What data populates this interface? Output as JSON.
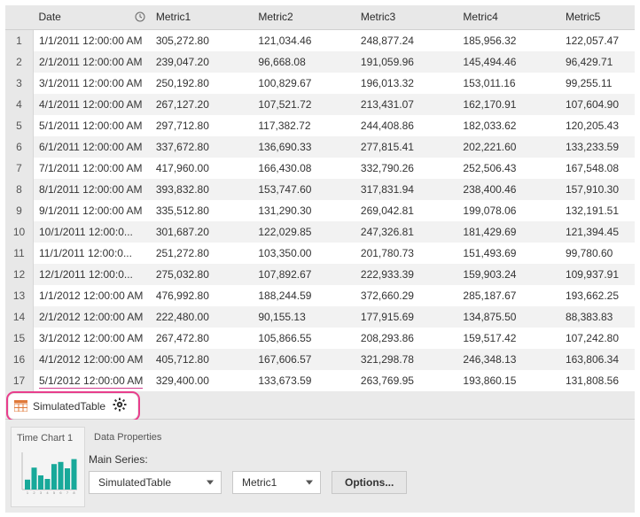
{
  "columns": [
    "Date",
    "Metric1",
    "Metric2",
    "Metric3",
    "Metric4",
    "Metric5"
  ],
  "rows": [
    {
      "n": 1,
      "date": "1/1/2011 12:00:00 AM",
      "m1": "305,272.80",
      "m2": "121,034.46",
      "m3": "248,877.24",
      "m4": "185,956.32",
      "m5": "122,057.47"
    },
    {
      "n": 2,
      "date": "2/1/2011 12:00:00 AM",
      "m1": "239,047.20",
      "m2": "96,668.08",
      "m3": "191,059.96",
      "m4": "145,494.46",
      "m5": "96,429.71"
    },
    {
      "n": 3,
      "date": "3/1/2011 12:00:00 AM",
      "m1": "250,192.80",
      "m2": "100,829.67",
      "m3": "196,013.32",
      "m4": "153,011.16",
      "m5": "99,255.11"
    },
    {
      "n": 4,
      "date": "4/1/2011 12:00:00 AM",
      "m1": "267,127.20",
      "m2": "107,521.72",
      "m3": "213,431.07",
      "m4": "162,170.91",
      "m5": "107,604.90"
    },
    {
      "n": 5,
      "date": "5/1/2011 12:00:00 AM",
      "m1": "297,712.80",
      "m2": "117,382.72",
      "m3": "244,408.86",
      "m4": "182,033.62",
      "m5": "120,205.43"
    },
    {
      "n": 6,
      "date": "6/1/2011 12:00:00 AM",
      "m1": "337,672.80",
      "m2": "136,690.33",
      "m3": "277,815.41",
      "m4": "202,221.60",
      "m5": "133,233.59"
    },
    {
      "n": 7,
      "date": "7/1/2011 12:00:00 AM",
      "m1": "417,960.00",
      "m2": "166,430.08",
      "m3": "332,790.26",
      "m4": "252,506.43",
      "m5": "167,548.08"
    },
    {
      "n": 8,
      "date": "8/1/2011 12:00:00 AM",
      "m1": "393,832.80",
      "m2": "153,747.60",
      "m3": "317,831.94",
      "m4": "238,400.46",
      "m5": "157,910.30"
    },
    {
      "n": 9,
      "date": "9/1/2011 12:00:00 AM",
      "m1": "335,512.80",
      "m2": "131,290.30",
      "m3": "269,042.81",
      "m4": "199,078.06",
      "m5": "132,191.51"
    },
    {
      "n": 10,
      "date": "10/1/2011 12:00:0...",
      "m1": "301,687.20",
      "m2": "122,029.85",
      "m3": "247,326.81",
      "m4": "181,429.69",
      "m5": "121,394.45"
    },
    {
      "n": 11,
      "date": "11/1/2011 12:00:0...",
      "m1": "251,272.80",
      "m2": "103,350.00",
      "m3": "201,780.73",
      "m4": "151,493.69",
      "m5": "99,780.60"
    },
    {
      "n": 12,
      "date": "12/1/2011 12:00:0...",
      "m1": "275,032.80",
      "m2": "107,892.67",
      "m3": "222,933.39",
      "m4": "159,903.24",
      "m5": "109,937.91"
    },
    {
      "n": 13,
      "date": "1/1/2012 12:00:00 AM",
      "m1": "476,992.80",
      "m2": "188,244.59",
      "m3": "372,660.29",
      "m4": "285,187.67",
      "m5": "193,662.25"
    },
    {
      "n": 14,
      "date": "2/1/2012 12:00:00 AM",
      "m1": "222,480.00",
      "m2": "90,155.13",
      "m3": "177,915.69",
      "m4": "134,875.50",
      "m5": "88,383.83"
    },
    {
      "n": 15,
      "date": "3/1/2012 12:00:00 AM",
      "m1": "267,472.80",
      "m2": "105,866.55",
      "m3": "208,293.86",
      "m4": "159,517.42",
      "m5": "107,242.80"
    },
    {
      "n": 16,
      "date": "4/1/2012 12:00:00 AM",
      "m1": "405,712.80",
      "m2": "167,606.57",
      "m3": "321,298.78",
      "m4": "246,348.13",
      "m5": "163,806.34"
    },
    {
      "n": 17,
      "date": "5/1/2012 12:00:00 AM",
      "m1": "329,400.00",
      "m2": "133,673.59",
      "m3": "263,769.95",
      "m4": "193,860.15",
      "m5": "131,808.56"
    }
  ],
  "tab": {
    "label": "SimulatedTable"
  },
  "bottom": {
    "chart_tab_label": "Time Chart 1",
    "props_tab_label": "Data Properties",
    "main_series_label": "Main Series:",
    "series_combo": "SimulatedTable",
    "metric_combo": "Metric1",
    "options_button": "Options..."
  },
  "chart_data": {
    "type": "bar",
    "categories": [
      "1",
      "2",
      "3",
      "4",
      "5",
      "6",
      "7",
      "8"
    ],
    "values": [
      28,
      62,
      40,
      30,
      72,
      78,
      60,
      86
    ],
    "title": "",
    "xlabel": "",
    "ylabel": "",
    "ylim": [
      0,
      100
    ]
  }
}
